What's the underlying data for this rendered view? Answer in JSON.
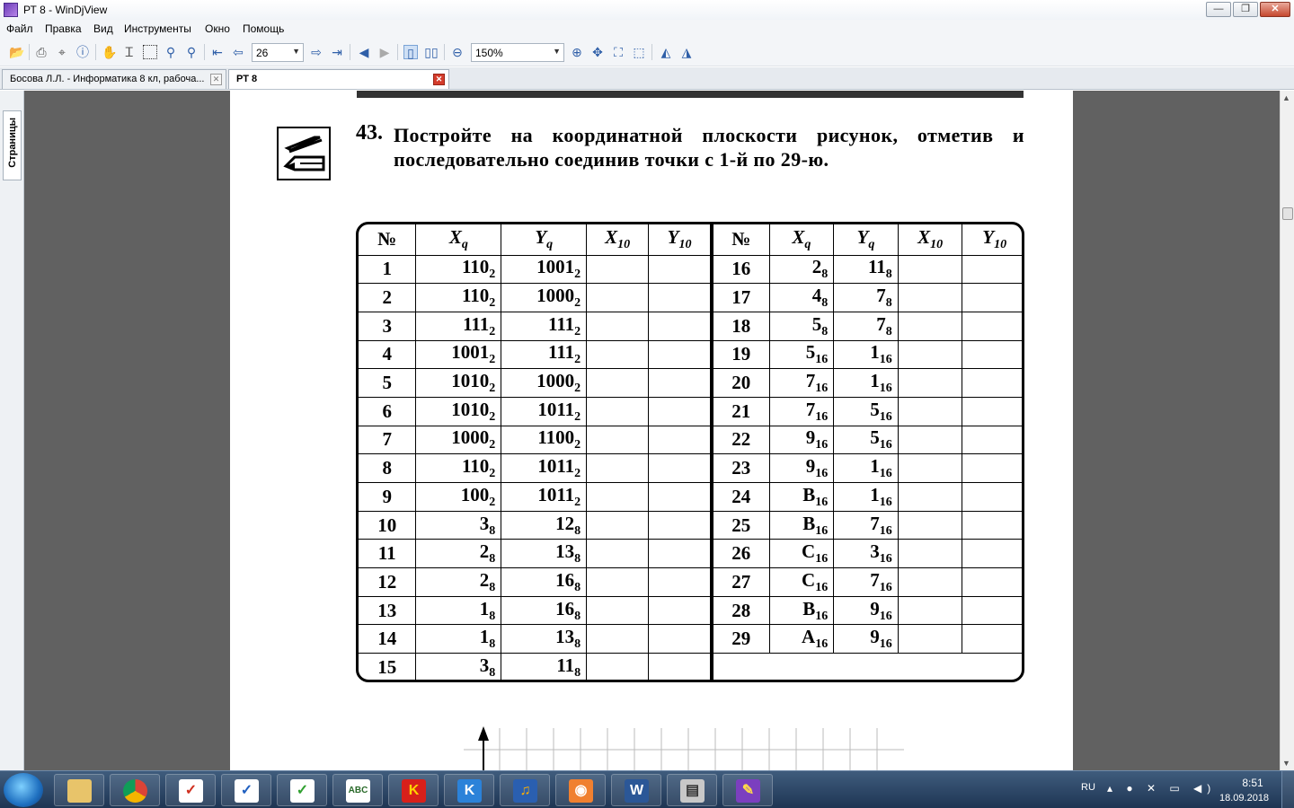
{
  "window": {
    "title": "РТ 8 - WinDjView",
    "minimize": "—",
    "maximize": "❐",
    "close": "✕"
  },
  "menu": [
    "Файл",
    "Правка",
    "Вид",
    "Инструменты",
    "Окно",
    "Помощь"
  ],
  "toolbar": {
    "page_number": "26",
    "zoom": "150%"
  },
  "tabs": [
    {
      "label": "Босова Л.Л. - Информатика 8 кл, рабоча...",
      "close": "✕"
    },
    {
      "label": "РТ 8",
      "close": "✕"
    }
  ],
  "side_panel": {
    "tab_label": "Страницы"
  },
  "document": {
    "task_number": "43.",
    "task_text": "Постройте на координатной плоскости рисунок, отметив и последовательно соединив точки с 1-й по 29-ю.",
    "headers": {
      "no": "№",
      "xq": "X",
      "xq_sub": "q",
      "yq": "Y",
      "yq_sub": "q",
      "x10": "X",
      "x10_sub": "10",
      "y10": "Y",
      "y10_sub": "10"
    },
    "points_left": [
      {
        "no": "1",
        "x": "110",
        "xb": "2",
        "y": "1001",
        "yb": "2"
      },
      {
        "no": "2",
        "x": "110",
        "xb": "2",
        "y": "1000",
        "yb": "2"
      },
      {
        "no": "3",
        "x": "111",
        "xb": "2",
        "y": "111",
        "yb": "2"
      },
      {
        "no": "4",
        "x": "1001",
        "xb": "2",
        "y": "111",
        "yb": "2"
      },
      {
        "no": "5",
        "x": "1010",
        "xb": "2",
        "y": "1000",
        "yb": "2"
      },
      {
        "no": "6",
        "x": "1010",
        "xb": "2",
        "y": "1011",
        "yb": "2"
      },
      {
        "no": "7",
        "x": "1000",
        "xb": "2",
        "y": "1100",
        "yb": "2"
      },
      {
        "no": "8",
        "x": "110",
        "xb": "2",
        "y": "1011",
        "yb": "2"
      },
      {
        "no": "9",
        "x": "100",
        "xb": "2",
        "y": "1011",
        "yb": "2"
      },
      {
        "no": "10",
        "x": "3",
        "xb": "8",
        "y": "12",
        "yb": "8"
      },
      {
        "no": "11",
        "x": "2",
        "xb": "8",
        "y": "13",
        "yb": "8"
      },
      {
        "no": "12",
        "x": "2",
        "xb": "8",
        "y": "16",
        "yb": "8"
      },
      {
        "no": "13",
        "x": "1",
        "xb": "8",
        "y": "16",
        "yb": "8"
      },
      {
        "no": "14",
        "x": "1",
        "xb": "8",
        "y": "13",
        "yb": "8"
      },
      {
        "no": "15",
        "x": "3",
        "xb": "8",
        "y": "11",
        "yb": "8"
      }
    ],
    "points_right": [
      {
        "no": "16",
        "x": "2",
        "xb": "8",
        "y": "11",
        "yb": "8"
      },
      {
        "no": "17",
        "x": "4",
        "xb": "8",
        "y": "7",
        "yb": "8"
      },
      {
        "no": "18",
        "x": "5",
        "xb": "8",
        "y": "7",
        "yb": "8"
      },
      {
        "no": "19",
        "x": "5",
        "xb": "16",
        "y": "1",
        "yb": "16"
      },
      {
        "no": "20",
        "x": "7",
        "xb": "16",
        "y": "1",
        "yb": "16"
      },
      {
        "no": "21",
        "x": "7",
        "xb": "16",
        "y": "5",
        "yb": "16"
      },
      {
        "no": "22",
        "x": "9",
        "xb": "16",
        "y": "5",
        "yb": "16"
      },
      {
        "no": "23",
        "x": "9",
        "xb": "16",
        "y": "1",
        "yb": "16"
      },
      {
        "no": "24",
        "x": "B",
        "xb": "16",
        "y": "1",
        "yb": "16"
      },
      {
        "no": "25",
        "x": "B",
        "xb": "16",
        "y": "7",
        "yb": "16"
      },
      {
        "no": "26",
        "x": "C",
        "xb": "16",
        "y": "3",
        "yb": "16"
      },
      {
        "no": "27",
        "x": "C",
        "xb": "16",
        "y": "7",
        "yb": "16"
      },
      {
        "no": "28",
        "x": "B",
        "xb": "16",
        "y": "9",
        "yb": "16"
      },
      {
        "no": "29",
        "x": "A",
        "xb": "16",
        "y": "9",
        "yb": "16"
      }
    ]
  },
  "taskbar": {
    "apps": [
      {
        "name": "explorer",
        "glyph": "",
        "bg": "#e8c46a"
      },
      {
        "name": "chrome",
        "glyph": "",
        "bg": "#e04a3a"
      },
      {
        "name": "tasks-red",
        "glyph": "✓",
        "bg": "#ffffff",
        "fg": "#d03020"
      },
      {
        "name": "tasks-blue",
        "glyph": "✓",
        "bg": "#ffffff",
        "fg": "#2060c0"
      },
      {
        "name": "tasks-green",
        "glyph": "✓",
        "bg": "#ffffff",
        "fg": "#30a030"
      },
      {
        "name": "abc",
        "glyph": "ABC",
        "bg": "#ffffff",
        "fg": "#2a6a2a"
      },
      {
        "name": "k-app",
        "glyph": "K",
        "bg": "#d8201a",
        "fg": "#ffd400"
      },
      {
        "name": "k-lite",
        "glyph": "K",
        "bg": "#2b82d9",
        "fg": "#ffffff"
      },
      {
        "name": "audio",
        "glyph": "♫",
        "bg": "#2a5fb0",
        "fg": "#ffb000"
      },
      {
        "name": "capture",
        "glyph": "◉",
        "bg": "#f08030",
        "fg": "#ffffff"
      },
      {
        "name": "word",
        "glyph": "W",
        "bg": "#2b5797",
        "fg": "#ffffff"
      },
      {
        "name": "scanner",
        "glyph": "▤",
        "bg": "#c8c8c8",
        "fg": "#333333"
      },
      {
        "name": "windjview",
        "glyph": "✎",
        "bg": "#7b3fbf",
        "fg": "#ffd94a"
      }
    ],
    "lang": "RU",
    "time": "8:51",
    "date": "18.09.2018"
  }
}
